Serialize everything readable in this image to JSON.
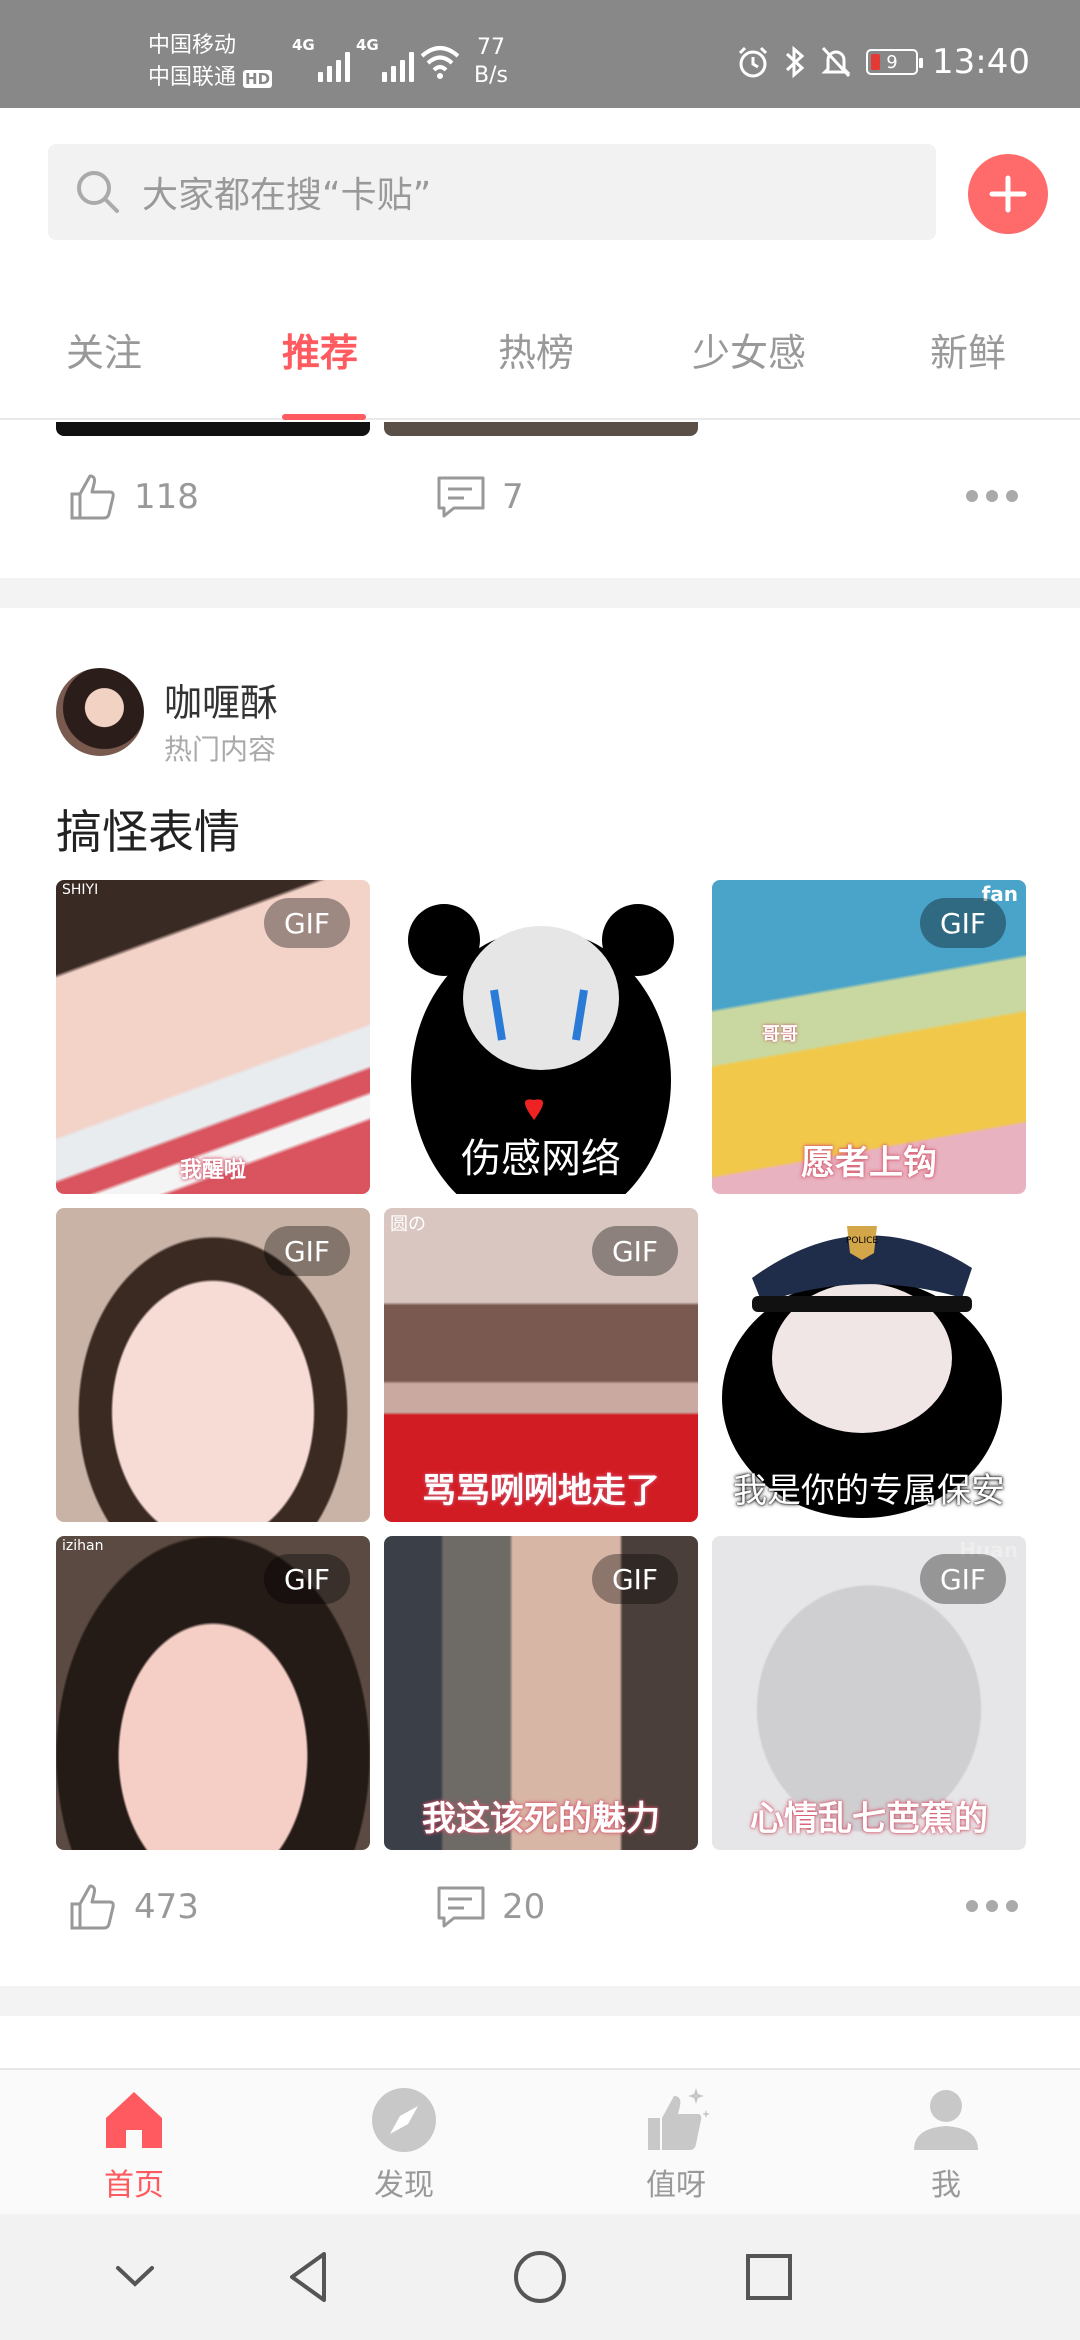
{
  "status_bar": {
    "carrier_1": "中国移动",
    "carrier_2": "中国联通",
    "hd_badge": "HD",
    "network_1": "4G",
    "network_2": "4G",
    "net_speed_value": "77",
    "net_speed_unit": "B/s",
    "battery_level": "9",
    "time": "13:40",
    "icons": [
      "alarm-icon",
      "bluetooth-icon",
      "mute-icon",
      "battery-icon"
    ]
  },
  "search": {
    "placeholder": "大家都在搜“卡贴”",
    "icon": "search-icon",
    "add_icon": "plus-icon",
    "add_color": "#ff6b6b"
  },
  "tabs": [
    {
      "label": "关注",
      "active": false
    },
    {
      "label": "推荐",
      "active": true
    },
    {
      "label": "热榜",
      "active": false
    },
    {
      "label": "少女感",
      "active": false
    },
    {
      "label": "新鲜",
      "active": false
    }
  ],
  "accent_color": "#ff5a5f",
  "prev_post": {
    "likes": "118",
    "comments": "7"
  },
  "post": {
    "author": "咖喱酥",
    "author_sub": "热门内容",
    "title": "搞怪表情",
    "likes": "473",
    "comments": "20",
    "images": [
      {
        "gif": "GIF",
        "caption": "我醒啦",
        "corner": "SHIYI"
      },
      {
        "gif": "",
        "caption": "伤感网络",
        "corner": ""
      },
      {
        "gif": "GIF",
        "caption": "愿者上钩",
        "corner": "fan",
        "tag": "哥哥"
      },
      {
        "gif": "GIF",
        "caption": "",
        "corner": ""
      },
      {
        "gif": "GIF",
        "caption": "骂骂咧咧地走了",
        "corner": "圆の"
      },
      {
        "gif": "",
        "caption": "我是你的专属保安",
        "corner": "",
        "hat_text": "POLICE"
      },
      {
        "gif": "GIF",
        "caption": "",
        "corner": "izihan"
      },
      {
        "gif": "GIF",
        "caption": "我这该死的魅力",
        "corner": ""
      },
      {
        "gif": "GIF",
        "caption": "心情乱七芭蕉的",
        "corner": "Huan"
      }
    ]
  },
  "bottom_nav": [
    {
      "label": "首页",
      "icon": "home-icon",
      "active": true
    },
    {
      "label": "发现",
      "icon": "compass-icon",
      "active": false
    },
    {
      "label": "值呀",
      "icon": "thumbs-sparkle-icon",
      "active": false
    },
    {
      "label": "我",
      "icon": "profile-icon",
      "active": false
    }
  ]
}
